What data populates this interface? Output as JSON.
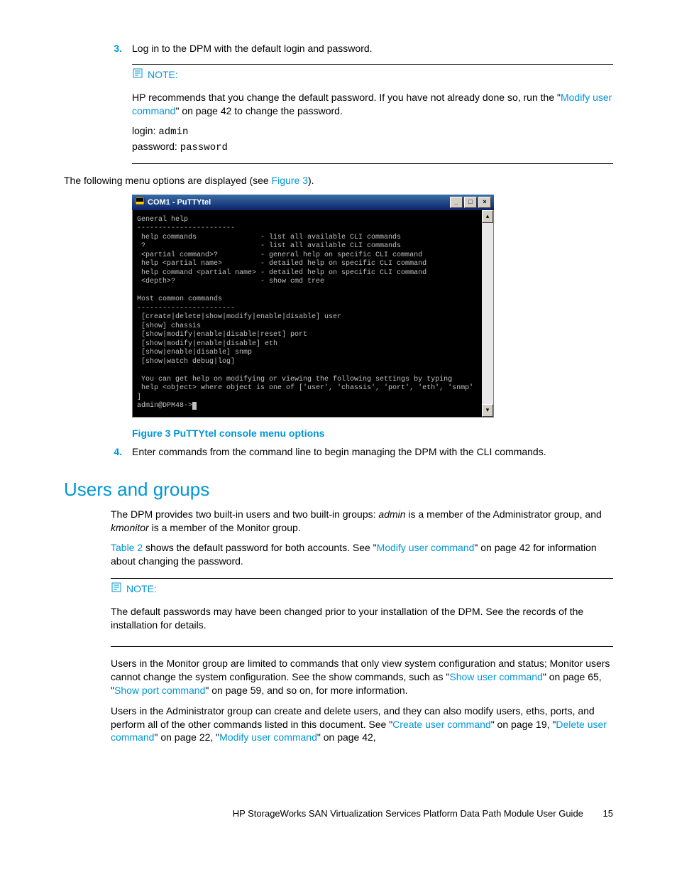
{
  "step3": {
    "num": "3.",
    "text": "Log in to the DPM with the default login and password."
  },
  "note1": {
    "label": "NOTE:",
    "body_pre": "HP recommends that you change the default password. If you have not already done so, run the \"",
    "body_link": "Modify user command",
    "body_post": "\" on page 42 to change the password.",
    "login_label": "login:",
    "login_value": "admin",
    "password_label": "password:",
    "password_value": "password"
  },
  "menu_intro_pre": "The following menu options are displayed (see ",
  "menu_intro_link": "Figure 3",
  "menu_intro_post": ").",
  "terminal": {
    "title": "COM1 - PuTTYtel",
    "content": "General help\n-----------------------\n help commands               - list all available CLI commands\n ?                           - list all available CLI commands\n <partial command>?          - general help on specific CLI command\n help <partial name>         - detailed help on specific CLI command\n help command <partial name> - detailed help on specific CLI command\n <depth>?                    - show cmd tree\n\nMost common commands\n-----------------------\n [create|delete|show|modify|enable|disable] user\n [show] chassis\n [show|modify|enable|disable|reset] port\n [show|modify|enable|disable] eth\n [show|enable|disable] snmp\n [show|watch debug|log]\n\n You can get help on modifying or viewing the following settings by typing\n help <object> where object is one of ['user', 'chassis', 'port', 'eth', 'snmp'\n]\n",
    "prompt": "admin@DPM48->"
  },
  "figure_caption": "Figure 3 PuTTYtel console menu options",
  "step4": {
    "num": "4.",
    "text": "Enter commands from the command line to begin managing the DPM with the CLI commands."
  },
  "section_heading": "Users and groups",
  "ug_p1_a": "The DPM provides two built-in users and two built-in groups: ",
  "ug_p1_admin": "admin",
  "ug_p1_b": " is a member of the Administrator group, and ",
  "ug_p1_kmon": "kmonitor",
  "ug_p1_c": " is a member of the Monitor group.",
  "ug_p2_link1": "Table 2",
  "ug_p2_a": " shows the default password for both accounts. See \"",
  "ug_p2_link2": "Modify user command",
  "ug_p2_b": "\" on page 42 for information about changing the password.",
  "note2": {
    "label": "NOTE:",
    "body": "The default passwords may have been changed prior to your installation of the DPM. See the records of the installation for details."
  },
  "ug_p3_a": "Users in the Monitor group are limited to commands that only view system configuration and status; Monitor users cannot change the system configuration. See the show commands, such as \"",
  "ug_p3_link1": "Show user command",
  "ug_p3_b": "\" on page 65, \"",
  "ug_p3_link2": "Show port command",
  "ug_p3_c": "\" on page 59, and so on, for more information.",
  "ug_p4_a": "Users in the Administrator group can create and delete users, and they can also modify users, eths, ports, and perform all of the other commands listed in this document. See \"",
  "ug_p4_link1": "Create user command",
  "ug_p4_b": "\" on page 19, \"",
  "ug_p4_link2": "Delete user command",
  "ug_p4_c": "\" on page 22, \"",
  "ug_p4_link3": "Modify user command",
  "ug_p4_d": "\" on page 42,",
  "footer_text": "HP StorageWorks SAN Virtualization Services Platform Data Path Module User Guide",
  "footer_page": "15"
}
